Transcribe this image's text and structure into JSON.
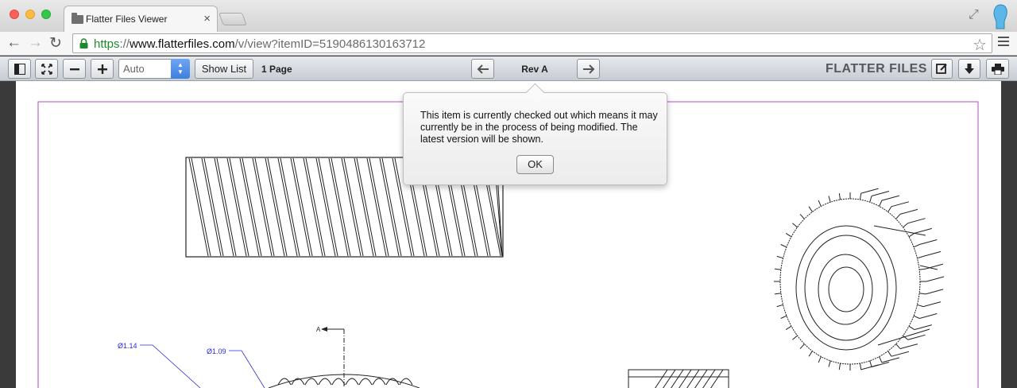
{
  "browser": {
    "tab_title": "Flatter Files Viewer",
    "tab_close": "×",
    "url_scheme": "https",
    "url_sep": "://",
    "url_host": "www.flatterfiles.com",
    "url_path": "/v/view?itemID=5190486130163712"
  },
  "viewer": {
    "zoom_select": "Auto",
    "show_list_label": "Show List",
    "page_count": "1 Page",
    "revision": "Rev A",
    "brand": "FLATTER FILES"
  },
  "popover": {
    "message": "This item is currently checked out which means it may currently be in the process of being modified. The latest version will be shown.",
    "ok_label": "OK"
  },
  "drawing": {
    "dim_1": "Ø1.14",
    "dim_2": "Ø1.09",
    "section_label": "A"
  },
  "colors": {
    "border_magenta": "#b04fc0",
    "dimension_blue": "#2b2bd6",
    "select_blue": "#3c7fe0"
  }
}
